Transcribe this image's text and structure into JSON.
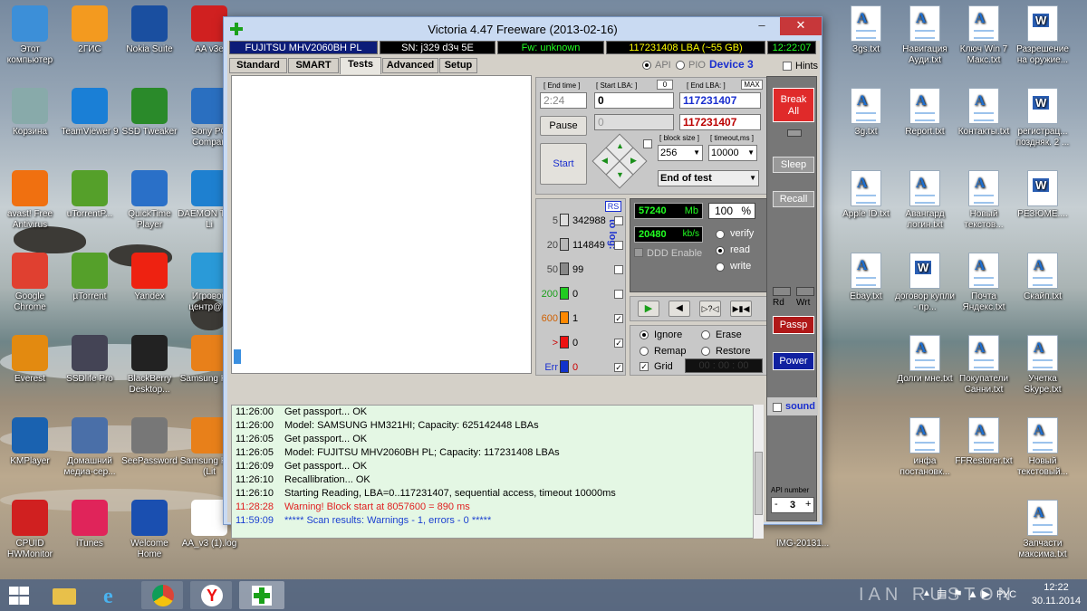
{
  "window": {
    "title": "Victoria 4.47  Freeware (2013-02-16)"
  },
  "info": {
    "drive": "FUJITSU MHV2060BH PL",
    "sn": "SN: j329   d3ч 5E",
    "fw": "Fw: unknown",
    "lba": "117231408 LBA (~55 GB)",
    "clock": "12:22:07"
  },
  "tabs": [
    "Standard",
    "SMART",
    "Tests",
    "Advanced",
    "Setup"
  ],
  "mode": {
    "api": "API",
    "pio": "PIO",
    "device": "Device 3",
    "hints": "Hints"
  },
  "test": {
    "end_time_label": "[ End time ]",
    "end_time": "2:24",
    "start_lba_label": "[ Start LBA: ]",
    "start_lba_small": "0",
    "start_lba": "0",
    "end_lba_label": "[ End LBA: ]",
    "max": "MAX",
    "end_lba": "117231407",
    "end_lba2": "117231407",
    "field2": "0",
    "pause": "Pause",
    "start": "Start",
    "block_size_label": "[ block size ]",
    "block_size": "256",
    "timeout_label": "[ timeout,ms ]",
    "timeout": "10000",
    "end_action": "End of test"
  },
  "counters": {
    "rs": "RS",
    "to_log": "to log:",
    "rows": [
      {
        "label": "5",
        "value": "342988",
        "color": "#dddddd"
      },
      {
        "label": "20",
        "value": "114849",
        "color": "#b8b8b8"
      },
      {
        "label": "50",
        "value": "99",
        "color": "#888888"
      },
      {
        "label": "200",
        "value": "0",
        "color": "#22cc22"
      },
      {
        "label": "600",
        "value": "1",
        "color": "#ff8800"
      },
      {
        "label": ">",
        "value": "0",
        "color": "#ee1111"
      },
      {
        "label": "Err",
        "value": "0",
        "color": "#1133cc"
      }
    ]
  },
  "stats": {
    "mb": "57240",
    "mb_unit": "Mb",
    "pct": "100",
    "pct_unit": "%",
    "speed": "20480",
    "speed_unit": "kb/s",
    "ddd": "DDD Enable",
    "verify": "verify",
    "read": "read",
    "write": "write"
  },
  "actions": {
    "ignore": "Ignore",
    "erase": "Erase",
    "remap": "Remap",
    "restore": "Restore",
    "grid": "Grid",
    "grid_time": "00 : 00 : 00"
  },
  "right": {
    "break_all": "Break All",
    "sleep": "Sleep",
    "recall": "Recall",
    "rd": "Rd",
    "wrt": "Wrt",
    "passp": "Passp",
    "power": "Power",
    "sound": "sound",
    "api_number_label": "API number",
    "api_number": "3"
  },
  "log": [
    {
      "t": "11:26:00",
      "m": "Get passport... OK",
      "c": "#000000"
    },
    {
      "t": "11:26:00",
      "m": "Model: SAMSUNG HM321HI; Capacity: 625142448 LBAs",
      "c": "#000000"
    },
    {
      "t": "11:26:05",
      "m": "Get passport... OK",
      "c": "#000000"
    },
    {
      "t": "11:26:05",
      "m": "Model: FUJITSU MHV2060BH PL; Capacity: 117231408 LBAs",
      "c": "#000000"
    },
    {
      "t": "11:26:09",
      "m": "Get passport... OK",
      "c": "#000000"
    },
    {
      "t": "11:26:10",
      "m": "Recallibration... OK",
      "c": "#000000"
    },
    {
      "t": "11:26:10",
      "m": "Starting Reading, LBA=0..117231407, sequential access, timeout 10000ms",
      "c": "#000000"
    },
    {
      "t": "11:28:28",
      "m": "Warning! Block start at 8057600 = 890 ms",
      "c": "#e02020"
    },
    {
      "t": "11:59:09",
      "m": "***** Scan results: Warnings - 1, errors - 0 *****",
      "c": "#1a3fd0"
    }
  ],
  "desktop_left": [
    {
      "label": "Этот компьютер"
    },
    {
      "label": "2ГИС"
    },
    {
      "label": "Nokia Suite"
    },
    {
      "label": "AA v3e"
    },
    {
      "label": "Корзина"
    },
    {
      "label": "TeamViewer 9"
    },
    {
      "label": "SSD Tweaker"
    },
    {
      "label": "Sony PC Compan"
    },
    {
      "label": "avast! Free Antivirus"
    },
    {
      "label": "uTorrentP..."
    },
    {
      "label": "QuickTime Player"
    },
    {
      "label": "DAEMON Tools Li"
    },
    {
      "label": "Google Chrome"
    },
    {
      "label": "µTorrent"
    },
    {
      "label": "Yandex"
    },
    {
      "label": "Игровой центр@M"
    },
    {
      "label": "Everest"
    },
    {
      "label": "SSDlife Pro"
    },
    {
      "label": "BlackBerry Desktop..."
    },
    {
      "label": "Samsung Kies"
    },
    {
      "label": "KMPlayer"
    },
    {
      "label": "Домашний медиа-сер..."
    },
    {
      "label": "SeePassword"
    },
    {
      "label": "Samsung Kies (Lit"
    },
    {
      "label": "CPUID HWMonitor"
    },
    {
      "label": "iTunes"
    },
    {
      "label": "Welcome Home"
    },
    {
      "label": "AA_v3 (1).log"
    }
  ],
  "desktop_right": [
    {
      "label": "Зgs.txt"
    },
    {
      "label": "Навигация Ауди.txt"
    },
    {
      "label": "Ключ Win 7 Макс.txt"
    },
    {
      "label": "Разрешение на оружие..."
    },
    {
      "label": "Зg.txt"
    },
    {
      "label": "Report.txt"
    },
    {
      "label": "Контакты.txt"
    },
    {
      "label": "регистрац... поздняк. 2 ..."
    },
    {
      "label": "Apple ID.txt"
    },
    {
      "label": "Авангард логин.txt"
    },
    {
      "label": "Новый текстов..."
    },
    {
      "label": "РЕЗЮМЕ...."
    },
    {
      "label": "Ebay.txt"
    },
    {
      "label": "договор купли - пр..."
    },
    {
      "label": "Почта Яндекс.txt"
    },
    {
      "label": "Скайп.txt"
    },
    {
      "label": "Долги мне.txt"
    },
    {
      "label": "Покупатели Санни.txt"
    },
    {
      "label": "Учетка Skype.txt"
    },
    {
      "label": "инфа постановк..."
    },
    {
      "label": "FFRestorer.txt"
    },
    {
      "label": "Новый текстовый..."
    },
    {
      "label": "IMG-20131..."
    },
    {
      "label": "Запчасти максима.txt"
    }
  ],
  "taskbar": {
    "watermark": "IAN RUSTON",
    "lang": "РУС",
    "time": "12:22",
    "date": "30.11.2014"
  }
}
